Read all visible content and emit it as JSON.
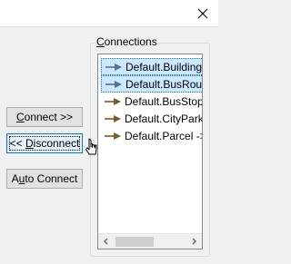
{
  "window": {
    "close_icon": "close-icon"
  },
  "connections": {
    "title": "Connections",
    "items": [
      {
        "label": "Default.Building",
        "selected": true,
        "icon": "connection-arrow-icon",
        "color": "#5a6f8a"
      },
      {
        "label": "Default.BusRout",
        "selected": true,
        "icon": "connection-arrow-icon",
        "color": "#5a6f8a"
      },
      {
        "label": "Default.BusStops",
        "selected": false,
        "icon": "connection-arrow-icon",
        "color": "#7a5a2a"
      },
      {
        "label": "Default.CityPark",
        "selected": false,
        "icon": "connection-arrow-icon",
        "color": "#7a5a2a"
      },
      {
        "label": "Default.Parcel ->",
        "selected": false,
        "icon": "connection-arrow-icon",
        "color": "#7a5a2a"
      }
    ]
  },
  "buttons": {
    "connect": "Connect >>",
    "disconnect": "<< Disconnect",
    "auto_connect": "Auto Connect"
  },
  "colors": {
    "selection": "#cce8ff",
    "focus": "#0078d7"
  }
}
